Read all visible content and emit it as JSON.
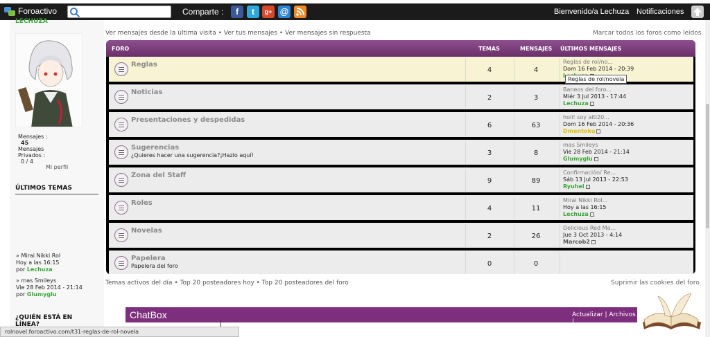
{
  "topbar": {
    "brand": "Foroactivo",
    "search_placeholder": "",
    "share_label": "Comparte :",
    "social_icons": [
      "facebook-icon",
      "twitter-icon",
      "google-plus-icon",
      "email-icon",
      "rss-icon"
    ],
    "welcome": "Bienvenido/a Lechuza",
    "notifications": "Notificaciones"
  },
  "sidebar": {
    "username": "LECHUZA",
    "stats": {
      "messages_label": "Mensajes :",
      "messages_value": "45",
      "private_label": "Mensajes Privados :",
      "private_value": "0 / 4"
    },
    "profile_link": "Mi perfil",
    "latest_heading": "ÚLTIMOS TEMAS",
    "latest_topics": [
      {
        "title": "» Mirai Nikki Rol",
        "date": "Hoy a las 16:15",
        "by": "por",
        "user": "Lechuza"
      },
      {
        "title": "» mas Smileys",
        "date": "Vie 28 Feb 2014 - 21:14",
        "by": "por",
        "user": "Glumyglu"
      }
    ],
    "online_heading": "¿QUIÉN ESTÁ EN LÍNEA?"
  },
  "main": {
    "top_links": "Ver mensajes desde la última visita • Ver tus mensajes • Ver mensajes sin respuesta",
    "mark_read": "Marcar todos los foros como leídos",
    "headers": {
      "foro": "FORO",
      "temas": "TEMAS",
      "mensajes": "MENSAJES",
      "ultimos": "ÚLTIMOS MENSAJES"
    },
    "forums": [
      {
        "title": "Reglas",
        "desc": "",
        "topics": "4",
        "posts": "4",
        "last_title": "Reglas de rol/no...",
        "last_date": "Dom 16 Feb 2014 - 20:39",
        "last_user": "Lechuza"
      },
      {
        "title": "Noticias",
        "desc": "",
        "topics": "2",
        "posts": "3",
        "last_title": "Baneos del foro...",
        "last_date": "Miér 3 Jul 2013 - 17:44",
        "last_user": "Lechuza"
      },
      {
        "title": "Presentaciones y despedidas",
        "desc": "",
        "topics": "6",
        "posts": "63",
        "last_title": "holi! soy aiti20...",
        "last_date": "Dom 16 Feb 2014 - 20:36",
        "last_user": "Dmentoku"
      },
      {
        "title": "Sugerencias",
        "desc": "¿Quieres hacer una sugerencia?¡Hazlo aquí!",
        "topics": "3",
        "posts": "8",
        "last_title": "mas Smileys",
        "last_date": "Vie 28 Feb 2014 - 21:14",
        "last_user": "Glumyglu"
      },
      {
        "title": "Zona del Staff",
        "desc": "",
        "topics": "9",
        "posts": "89",
        "last_title": "Confirmación/ Re...",
        "last_date": "Sáb 13 Jul 2013 - 22:53",
        "last_user": "Ryuhei"
      },
      {
        "title": "Roles",
        "desc": "",
        "topics": "4",
        "posts": "11",
        "last_title": "Mirai Nikki Rol...",
        "last_date": "Hoy a las 16:15",
        "last_user": "Lechuza"
      },
      {
        "title": "Novelas",
        "desc": "",
        "topics": "2",
        "posts": "26",
        "last_title": "Delicious Red Ma...",
        "last_date": "Jue 3 Oct 2013 - 4:14",
        "last_user": "Marcob2"
      },
      {
        "title": "Papelera",
        "desc": "Papelera del foro",
        "topics": "0",
        "posts": "0",
        "last_title": "",
        "last_date": "",
        "last_user": ""
      }
    ],
    "tooltip": "Reglas de rol/novela",
    "footer_links": "Temas activos del día • Top 20 posteadores hoy • Top 20 posteadores del foro",
    "cookies": "Suprimir las cookies del foro"
  },
  "chatbox": {
    "title": "ChatBox",
    "links": "Actualizar | Archivos |"
  },
  "statusbar": "rolnovel.foroactivo.com/t31-reglas-de-rol-novela",
  "colors": {
    "purple_header": "#7d2f7d",
    "user_green": "#3aa637",
    "highlight_row": "#f8f3d2"
  }
}
